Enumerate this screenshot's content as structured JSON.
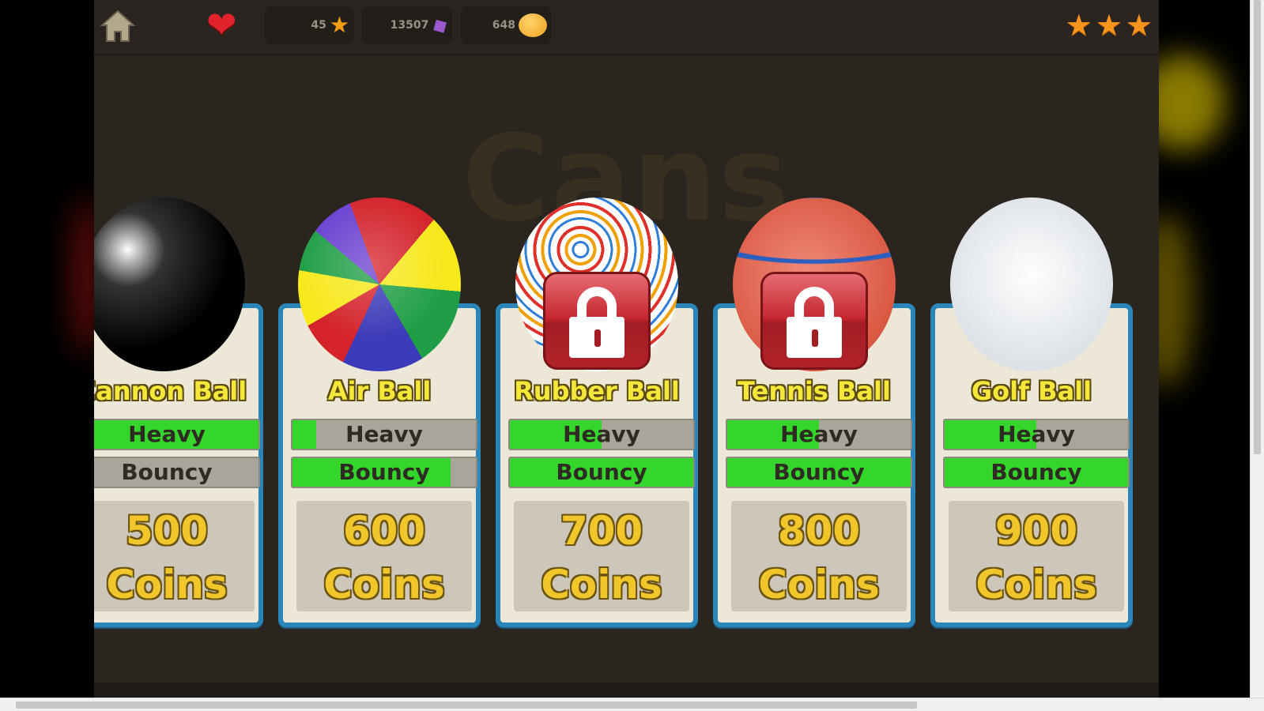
{
  "hud": {
    "stars_count": "45",
    "gems_count": "13507",
    "coins_count": "648",
    "level_rating_stars": 3
  },
  "section_title": "Cans",
  "balls": [
    {
      "name": "Cannon Ball",
      "heavy_label": "Heavy",
      "bouncy_label": "Bouncy",
      "heavy": 1.0,
      "bouncy": 0.05,
      "price_amount": "500",
      "price_unit": "Coins",
      "locked": false
    },
    {
      "name": "Air Ball",
      "heavy_label": "Heavy",
      "bouncy_label": "Bouncy",
      "heavy": 0.13,
      "bouncy": 0.86,
      "price_amount": "600",
      "price_unit": "Coins",
      "locked": false
    },
    {
      "name": "Rubber Ball",
      "heavy_label": "Heavy",
      "bouncy_label": "Bouncy",
      "heavy": 0.5,
      "bouncy": 1.0,
      "price_amount": "700",
      "price_unit": "Coins",
      "locked": true
    },
    {
      "name": "Tennis Ball",
      "heavy_label": "Heavy",
      "bouncy_label": "Bouncy",
      "heavy": 0.5,
      "bouncy": 1.0,
      "price_amount": "800",
      "price_unit": "Coins",
      "locked": true
    },
    {
      "name": "Golf Ball",
      "heavy_label": "Heavy",
      "bouncy_label": "Bouncy",
      "heavy": 0.5,
      "bouncy": 1.0,
      "price_amount": "900",
      "price_unit": "Coins",
      "locked": false
    }
  ],
  "colors": {
    "meter_fill": "#35d62c",
    "card_border": "#2a86b8",
    "name_text": "#f5e63a"
  }
}
